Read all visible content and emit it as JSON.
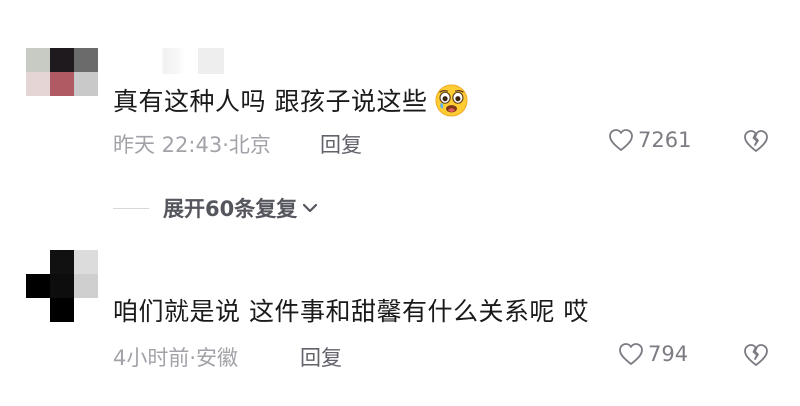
{
  "comments": [
    {
      "text": "真有这种人吗 跟孩子说这些",
      "time": "昨天 22:43·北京",
      "reply_label": "回复",
      "likes": "7261",
      "emoji": "crying-face-emoji",
      "avatar_colors": [
        "#c8cbc4",
        "#1f1a1d",
        "#6b6b6b",
        "#e5d5d5",
        "#b05a64",
        "#c9c9c9"
      ]
    },
    {
      "text": "咱们就是说 这件事和甜馨有什么关系呢 哎",
      "time": "4小时前·安徽",
      "reply_label": "回复",
      "likes": "794",
      "avatar_colors": [
        "#ffffff",
        "#111111",
        "#dcdcdc",
        "#000000",
        "#0d0d0d",
        "#cfcfcf"
      ]
    }
  ],
  "expand_replies": {
    "label": "展开60条复复"
  },
  "icons": {
    "like": "heart-outline-icon",
    "dislike": "broken-heart-icon",
    "expand": "chevron-down-icon"
  },
  "colors": {
    "text": "#1a1a1a",
    "meta": "#a2a2a8",
    "reply": "#61626a"
  }
}
